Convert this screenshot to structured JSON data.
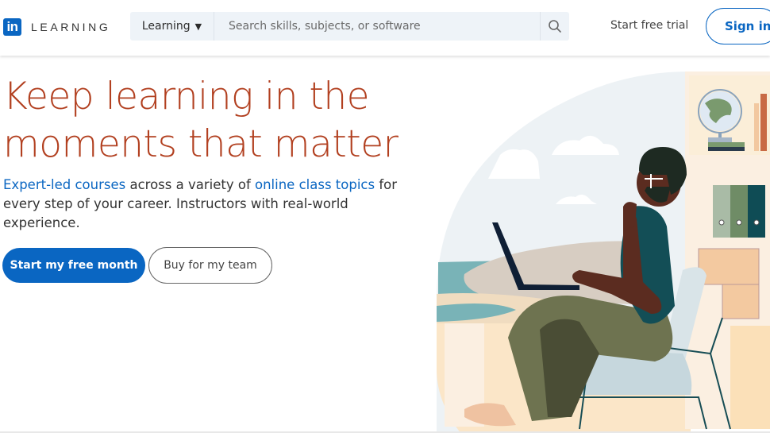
{
  "header": {
    "logo_mark": "in",
    "logo_text": "LEARNING",
    "search_category": "Learning",
    "search_placeholder": "Search skills, subjects, or software",
    "search_icon": "search-icon",
    "start_trial_label": "Start free trial",
    "sign_in_label": "Sign in"
  },
  "hero": {
    "title_line1": "Keep learning in the",
    "title_line2": "moments that matter",
    "subtitle": {
      "link1": "Expert-led courses",
      "text1": " across a variety of ",
      "link2": "online class topics",
      "text2": " for every step of your career. Instructors with real-world experience."
    },
    "primary_button": "Start my free month",
    "secondary_button": "Buy for my team"
  },
  "illustration": {
    "description": "person-with-laptop-in-chair"
  },
  "colors": {
    "brand_blue": "#0a66c2",
    "title_orange": "#b24020",
    "search_bg": "#eef3f8"
  }
}
